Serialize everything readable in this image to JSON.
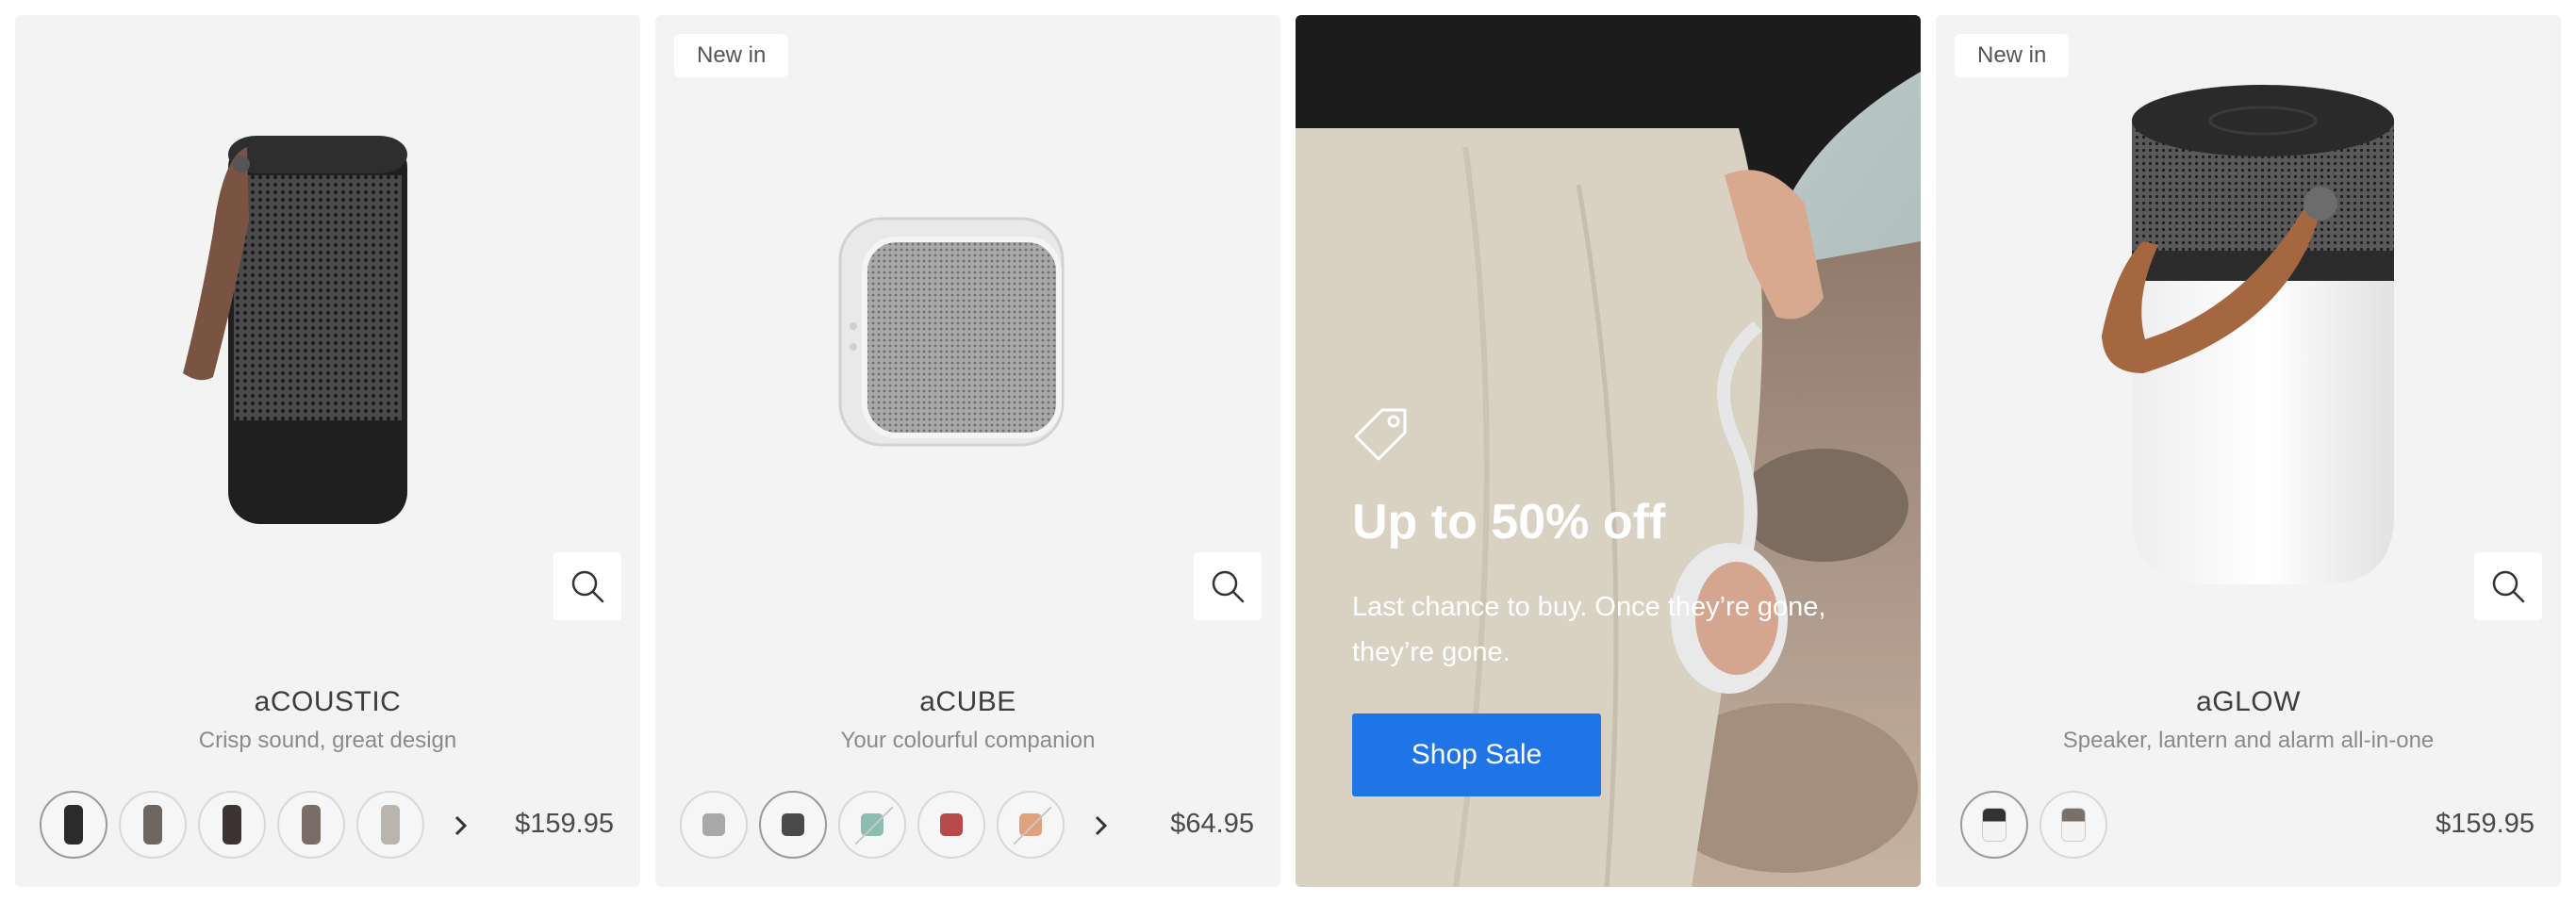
{
  "products": [
    {
      "name": "aCOUSTIC",
      "subtitle": "Crisp sound, great design",
      "price": "$159.95",
      "badge": "",
      "swatch_colors": [
        "#2b2b2b",
        "#6e6660",
        "#3a3532",
        "#7a6d66",
        "#b9b4ad"
      ]
    },
    {
      "name": "aCUBE",
      "subtitle": "Your colourful companion",
      "price": "$64.95",
      "badge": "New in",
      "swatch_colors": [
        "#a8a8a8",
        "#4a4a4a",
        "#8dbdb1",
        "#b84a4c",
        "#e0a27c"
      ]
    },
    {
      "name": "aGLOW",
      "subtitle": "Speaker, lantern and alarm all-in-one",
      "price": "$159.95",
      "badge": "New in",
      "swatch_colors": [
        "#333333",
        "#7b7068"
      ]
    }
  ],
  "promo": {
    "title": "Up to 50% off",
    "description": "Last chance to buy. Once they’re gone, they’re gone.",
    "button_label": "Shop Sale"
  },
  "colors": {
    "accent": "#1f74e8",
    "card_bg": "#f3f3f3"
  },
  "icons": {
    "quick_view": "search-icon",
    "next": "chevron-right-icon",
    "promo": "price-tag-icon"
  }
}
